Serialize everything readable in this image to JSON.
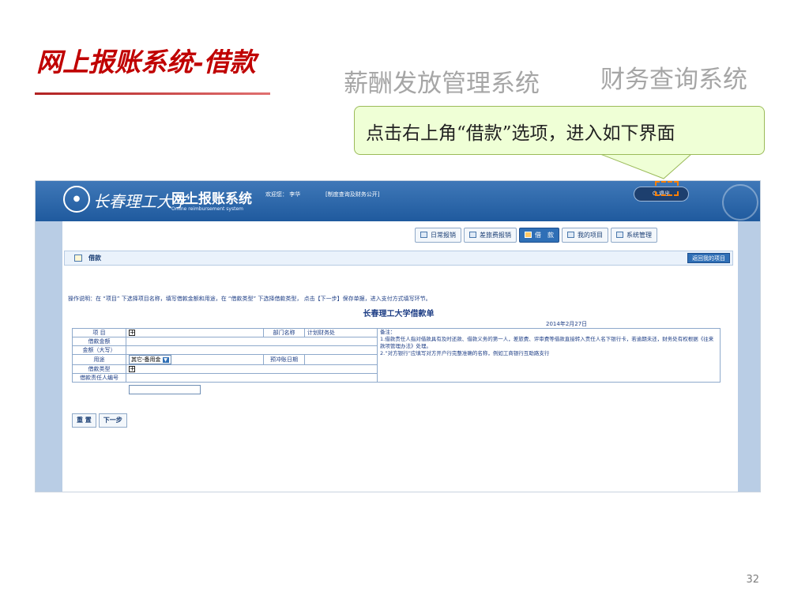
{
  "slide": {
    "title": "网上报账系统-借款",
    "nav_ghost_1": "薪酬发放管理系统",
    "nav_ghost_2": "财务查询系统",
    "callout": "点击右上角“借款”选项，进入如下界面",
    "page_number": "32"
  },
  "app": {
    "logo_text": "长春理工大学",
    "system_name": "网上报账系统",
    "system_subtitle": "Online reimbursement system",
    "welcome": "欢迎您：  李华",
    "policy_link": "[制度查询及财务公开]",
    "logout": "退出",
    "tabs": [
      {
        "label": "日常报销",
        "icon": "document-icon",
        "active": false
      },
      {
        "label": "差旅费报销",
        "icon": "luggage-icon",
        "active": false
      },
      {
        "label": "借　款",
        "icon": "money-icon",
        "active": true
      },
      {
        "label": "我的项目",
        "icon": "list-icon",
        "active": false
      },
      {
        "label": "系统管理",
        "icon": "settings-icon",
        "active": false
      }
    ],
    "section_title": "借款",
    "return_button": "返回我的项目",
    "instructions": "操作说明：在 “项目” 下选择项目名称，填写借款金额和用途，在 “借款类型” 下选择借款类型， 点击【下一步】保存单据，进入支付方式填写环节。",
    "form_title": "长春理工大学借款单",
    "form_date": "2014年2月27日",
    "form": {
      "project_label": "项  目",
      "dept_label": "部门名称",
      "dept_value": "计划财务处",
      "amount_label": "借款金额",
      "amount_upper_label": "金额（大写）",
      "purpose_label": "用途",
      "purpose_value": "其它-备用金",
      "writeoff_label": "预冲账日期",
      "loan_type_label": "借款类型",
      "responsible_id_label": "借款责任人编号",
      "notes_label": "备注：",
      "note_1": "1.借款责任人指对借款具有及时还款、借款义务的第一人，差旅费、评审费等借款直接转入责任人名下银行卡，若逾期未还，财务处有权根据《往来款项管理办法》处理。",
      "note_2": "2.“对方银行”应填写对方开户行完整准确的名称，例如工商银行互助路支行"
    },
    "buttons": {
      "reset": "重 置",
      "next": "下一步"
    }
  },
  "colors": {
    "banner": "#2a66a8",
    "title_red": "#c00000",
    "callout_bg": "#efffd6",
    "highlight": "#ff7f00"
  }
}
